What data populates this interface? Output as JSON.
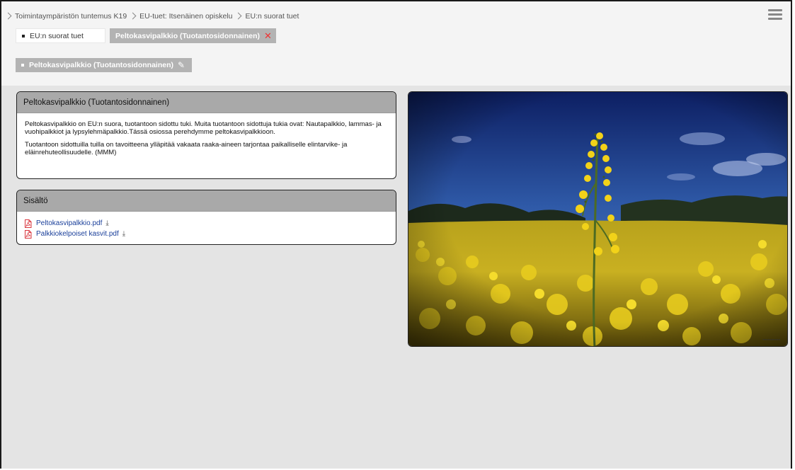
{
  "breadcrumb": {
    "items": [
      {
        "label": "Toimintaympäristön tuntemus K19"
      },
      {
        "label": "EU-tuet: Itsenäinen opiskelu"
      },
      {
        "label": "EU:n suorat tuet"
      }
    ]
  },
  "tabs": [
    {
      "label": "EU:n suorat tuet",
      "active": false
    },
    {
      "label": "Peltokasvipalkkio (Tuotantosidonnainen)",
      "active": true
    }
  ],
  "subtab": {
    "label": "Peltokasvipalkkio (Tuotantosidonnainen)"
  },
  "intro_card": {
    "title": "Peltokasvipalkkio (Tuotantosidonnainen)",
    "paragraph1": "Peltokasvipalkkio on EU:n suora, tuotantoon sidottu tuki. Muita tuotantoon sidottuja tukia ovat: Nautapalkkio, lammas- ja vuohipalkkiot ja lypsylehmäpalkkio.Tässä osiossa perehdymme peltokasvipalkkioon.",
    "paragraph2": "Tuotantoon sidottuilla tuilla on tavoitteena ylläpitää vakaata raaka-aineen tarjontaa paikalliselle elintarvike- ja eläinrehuteollisuudelle. (MMM)"
  },
  "content_card": {
    "title": "Sisältö",
    "files": [
      {
        "label": "Peltokasvipalkkio.pdf"
      },
      {
        "label": "Palkkiokelpoiset kasvit.pdf"
      }
    ]
  },
  "icons": {
    "menu": "hamburger-menu-icon",
    "close": "close-icon",
    "edit": "pencil-icon",
    "pdf": "pdf-file-icon",
    "download": "download-icon",
    "breadcrumb_separator": "chevron-right-icon"
  },
  "colors": {
    "tab_active_bg": "#b3b3b3",
    "card_header_bg": "#a9a9a9",
    "close": "#e33333",
    "link": "#1a3f9a",
    "pdf_icon": "#d9363e"
  }
}
